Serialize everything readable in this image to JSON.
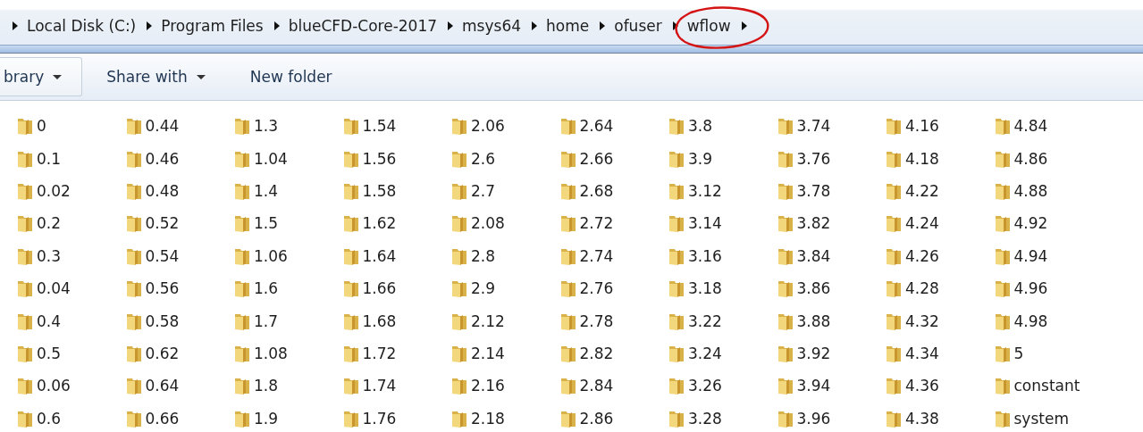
{
  "breadcrumb": {
    "items": [
      {
        "label": "Local Disk (C:)"
      },
      {
        "label": "Program Files"
      },
      {
        "label": "blueCFD-Core-2017"
      },
      {
        "label": "msys64"
      },
      {
        "label": "home"
      },
      {
        "label": "ofuser"
      },
      {
        "label": "wflow",
        "circled": true
      }
    ]
  },
  "toolbar": {
    "buttons": [
      {
        "label": "brary",
        "dropdown": true,
        "framed": true
      },
      {
        "label": "Share with",
        "dropdown": true,
        "framed": false
      },
      {
        "label": "New folder",
        "dropdown": false,
        "framed": false
      }
    ]
  },
  "folders": {
    "columns": [
      [
        "0",
        "0.1",
        "0.02",
        "0.2",
        "0.3",
        "0.04",
        "0.4",
        "0.5",
        "0.06",
        "0.6"
      ],
      [
        "0.44",
        "0.46",
        "0.48",
        "0.52",
        "0.54",
        "0.56",
        "0.58",
        "0.62",
        "0.64",
        "0.66"
      ],
      [
        "1.3",
        "1.04",
        "1.4",
        "1.5",
        "1.06",
        "1.6",
        "1.7",
        "1.08",
        "1.8",
        "1.9"
      ],
      [
        "1.54",
        "1.56",
        "1.58",
        "1.62",
        "1.64",
        "1.66",
        "1.68",
        "1.72",
        "1.74",
        "1.76"
      ],
      [
        "2.06",
        "2.6",
        "2.7",
        "2.08",
        "2.8",
        "2.9",
        "2.12",
        "2.14",
        "2.16",
        "2.18"
      ],
      [
        "2.64",
        "2.66",
        "2.68",
        "2.72",
        "2.74",
        "2.76",
        "2.78",
        "2.82",
        "2.84",
        "2.86"
      ],
      [
        "3.8",
        "3.9",
        "3.12",
        "3.14",
        "3.16",
        "3.18",
        "3.22",
        "3.24",
        "3.26",
        "3.28"
      ],
      [
        "3.74",
        "3.76",
        "3.78",
        "3.82",
        "3.84",
        "3.86",
        "3.88",
        "3.92",
        "3.94",
        "3.96"
      ],
      [
        "4.16",
        "4.18",
        "4.22",
        "4.24",
        "4.26",
        "4.28",
        "4.32",
        "4.34",
        "4.36",
        "4.38"
      ],
      [
        "4.84",
        "4.86",
        "4.88",
        "4.92",
        "4.94",
        "4.96",
        "4.98",
        "5",
        "constant",
        "system"
      ]
    ]
  }
}
